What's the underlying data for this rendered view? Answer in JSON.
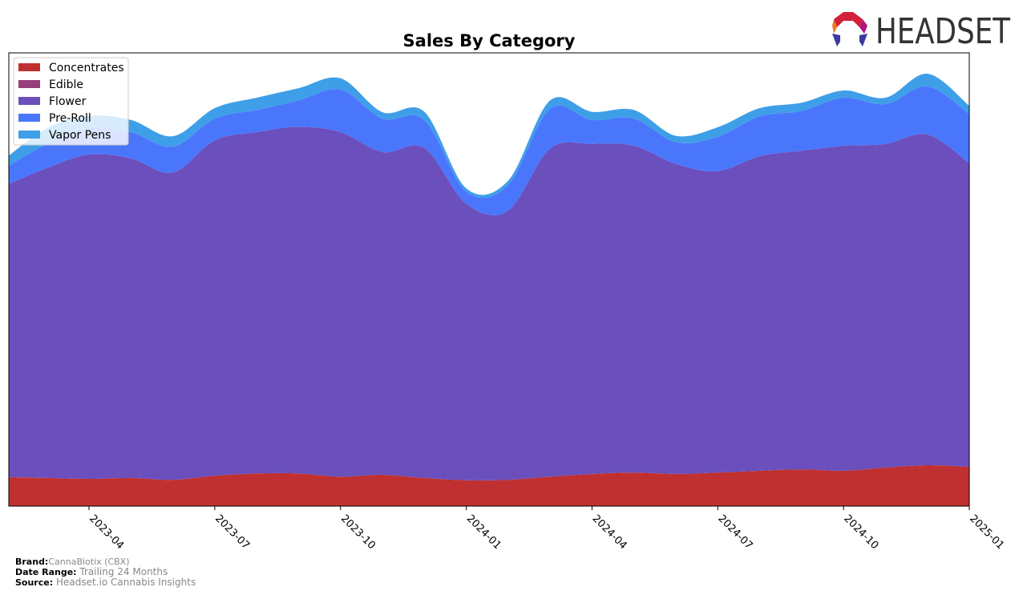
{
  "brand_logo": {
    "text": "HEADSET"
  },
  "footer": {
    "brand_label": "Brand:",
    "brand_value": "CannaBiotix (CBX)",
    "date_range_label": "Date Range:",
    "date_range_value": "Trailing 24 Months",
    "source_label": "Source:",
    "source_value": "Headset.io Cannabis Insights"
  },
  "chart_data": {
    "type": "area",
    "stacked": true,
    "title": "Sales By Category",
    "xlabel": "",
    "ylabel": "",
    "ylim": [
      0,
      100
    ],
    "grid": false,
    "legend_position": "top-left",
    "x_ticks": [
      "2023-04",
      "2023-07",
      "2023-10",
      "2024-01",
      "2024-04",
      "2024-07",
      "2024-10",
      "2025-01"
    ],
    "x": [
      "2023-02",
      "2023-03",
      "2023-04",
      "2023-05",
      "2023-06",
      "2023-07",
      "2023-08",
      "2023-09",
      "2023-10",
      "2023-11",
      "2023-12",
      "2024-01",
      "2024-02",
      "2024-03",
      "2024-04",
      "2024-05",
      "2024-06",
      "2024-07",
      "2024-08",
      "2024-09",
      "2024-10",
      "2024-11",
      "2024-12",
      "2025-01"
    ],
    "series": [
      {
        "name": "Concentrates",
        "color": "#c03030",
        "values": [
          6.4,
          6.2,
          6.0,
          6.2,
          5.8,
          6.7,
          7.2,
          7.2,
          6.5,
          6.9,
          6.2,
          5.7,
          5.8,
          6.5,
          7.1,
          7.4,
          7.1,
          7.4,
          7.8,
          8.1,
          7.8,
          8.5,
          9.0,
          8.7
        ]
      },
      {
        "name": "Edible",
        "color": "#983e7a",
        "values": [
          0,
          0,
          0,
          0,
          0,
          0,
          0,
          0,
          0,
          0,
          0,
          0,
          0,
          0,
          0,
          0,
          0,
          0,
          0,
          0,
          0,
          0,
          0,
          0
        ]
      },
      {
        "name": "Flower",
        "color": "#6a4fbd",
        "values": [
          64.3,
          68.4,
          71.6,
          70.5,
          67.8,
          74.0,
          75.3,
          76.5,
          76.0,
          71.2,
          72.8,
          61.0,
          59.4,
          72.4,
          72.8,
          72.1,
          68.4,
          66.5,
          69.4,
          70.3,
          71.7,
          71.4,
          73.0,
          67.0
        ]
      },
      {
        "name": "Pre-Roll",
        "color": "#4a76fc",
        "values": [
          3.9,
          5.3,
          5.8,
          5.8,
          5.7,
          4.8,
          4.9,
          5.8,
          9.4,
          7.4,
          6.2,
          2.7,
          5.7,
          8.8,
          5.3,
          6.0,
          4.8,
          7.6,
          8.8,
          8.8,
          10.6,
          8.8,
          10.6,
          10.8
        ]
      },
      {
        "name": "Vapor Pens",
        "color": "#3e9fe8",
        "values": [
          2.1,
          3.5,
          2.7,
          2.7,
          2.3,
          2.3,
          2.7,
          2.7,
          2.5,
          1.4,
          1.8,
          0.7,
          0.9,
          1.8,
          1.8,
          1.9,
          1.4,
          2.1,
          1.8,
          1.8,
          1.6,
          1.4,
          2.8,
          1.8
        ]
      }
    ]
  }
}
